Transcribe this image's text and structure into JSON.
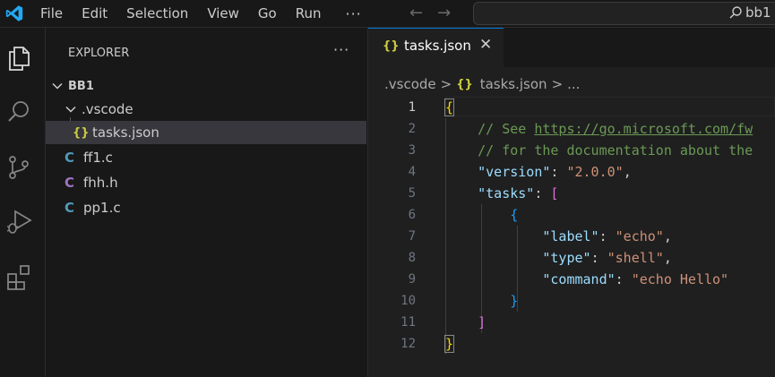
{
  "titlebar": {
    "menu": [
      "File",
      "Edit",
      "Selection",
      "View",
      "Go",
      "Run"
    ],
    "more": "···",
    "back_arrow": "←",
    "forward_arrow": "→",
    "search_text": "bb1"
  },
  "activitybar": {
    "icons": [
      "files-icon",
      "search-icon",
      "source-control-icon",
      "run-debug-icon",
      "extensions-icon"
    ]
  },
  "sidebar": {
    "title": "EXPLORER",
    "more": "···",
    "root": "BB1",
    "folder": ".vscode",
    "items": [
      {
        "name": "tasks.json",
        "icon": "{}",
        "icon_color": "#cbcb41",
        "selected": true
      },
      {
        "name": "ff1.c",
        "icon": "C",
        "icon_color": "#519aba"
      },
      {
        "name": "fhh.h",
        "icon": "C",
        "icon_color": "#a074c4"
      },
      {
        "name": "pp1.c",
        "icon": "C",
        "icon_color": "#519aba"
      }
    ]
  },
  "editor": {
    "tab": {
      "icon": "{}",
      "label": "tasks.json",
      "close": "✕"
    },
    "breadcrumb": {
      "folder": ".vscode",
      "file_icon": "{}",
      "file": "tasks.json",
      "tail": "..."
    },
    "line_numbers": [
      "1",
      "2",
      "3",
      "4",
      "5",
      "6",
      "7",
      "8",
      "9",
      "10",
      "11",
      "12"
    ],
    "code": {
      "l2_comment_prefix": "// See ",
      "l2_link": "https://go.microsoft.com/fw",
      "l3_comment": "// for the documentation about the",
      "version_key": "\"version\"",
      "version_val": "\"2.0.0\"",
      "tasks_key": "\"tasks\"",
      "label_key": "\"label\"",
      "label_val": "\"echo\"",
      "type_key": "\"type\"",
      "type_val": "\"shell\"",
      "command_key": "\"command\"",
      "command_val": "\"echo Hello\""
    }
  },
  "colors": {
    "accent": "#0078d4",
    "json_icon": "#cbcb41",
    "c_icon": "#519aba",
    "h_icon": "#a074c4"
  }
}
